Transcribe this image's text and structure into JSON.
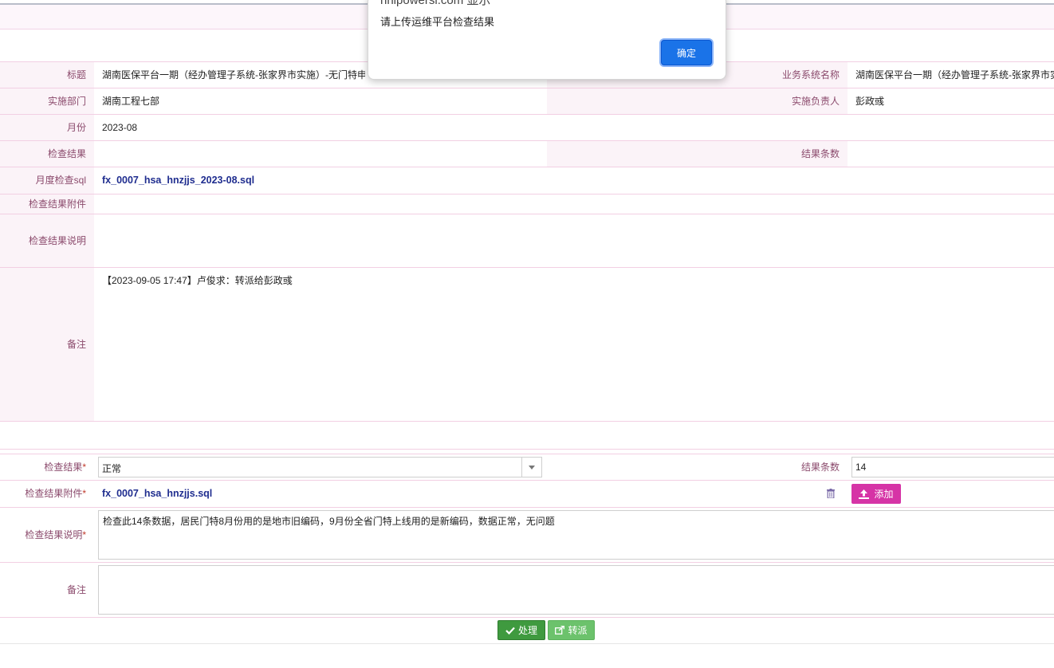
{
  "dialog": {
    "title": "hnipowersi.com 显示",
    "message": "请上传运维平台检查结果",
    "ok_label": "确定"
  },
  "info": {
    "title_label": "标题",
    "title_value": "湖南医保平台一期（经办管理子系统-张家界市实施）-无门特申请门特方数量",
    "system_label": "业务系统名称",
    "system_value": "湖南医保平台一期（经办管理子系统-张家界市实施）",
    "dept_label": "实施部门",
    "dept_value": "湖南工程七部",
    "owner_label": "实施负责人",
    "owner_value": "彭政彧",
    "month_label": "月份",
    "month_value": "2023-08",
    "result_label": "检查结果",
    "result_value": "",
    "count_label": "结果条数",
    "count_value": "",
    "sql_label": "月度检查sql",
    "sql_file": "fx_0007_hsa_hnzjjs_2023-08.sql",
    "attach_label": "检查结果附件",
    "desc_label": "检查结果说明",
    "remark_label": "备注",
    "remark_value": "【2023-09-05 17:47】卢俊求：转派给彭政彧"
  },
  "form": {
    "result_label": "检查结果",
    "result_value": "正常",
    "count_label": "结果条数",
    "count_value": "14",
    "attach_label": "检查结果附件",
    "attach_file": "fx_0007_hsa_hnzjjs.sql",
    "add_label": "添加",
    "desc_label": "检查结果说明",
    "desc_value": "检查此14条数据，居民门特8月份用的是地市旧编码，9月份全省门特上线用的是新编码，数据正常，无问题",
    "remark_label": "备注",
    "remark_value": "",
    "required_mark": "*"
  },
  "actions": {
    "process_label": "处理",
    "transfer_label": "转派"
  },
  "colors": {
    "label_bg": "#fbf3f8",
    "label_text": "#8b4a6c",
    "primary": "#1a73e8",
    "process_btn": "#3f9a3f",
    "transfer_btn": "#6cc26c",
    "add_btn": "#d633a6"
  }
}
